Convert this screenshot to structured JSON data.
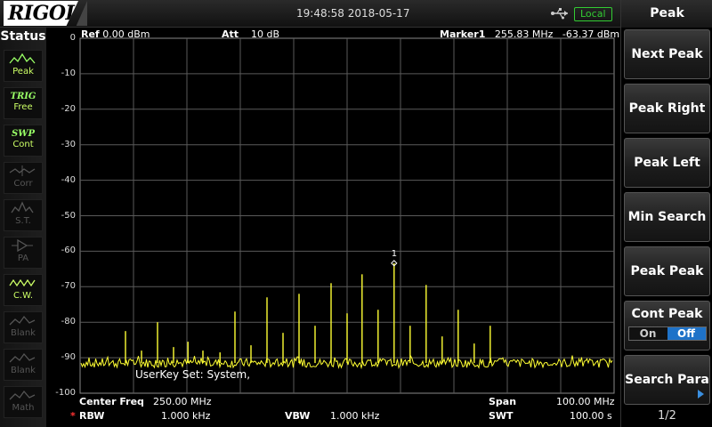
{
  "header": {
    "brand": "RIGOL",
    "datetime": "19:48:58 2018-05-17",
    "remote_status": "Local"
  },
  "status_panel": {
    "title": "Status",
    "items": [
      {
        "icon": "peak-icon",
        "top_label": "",
        "label": "Peak",
        "active": true
      },
      {
        "icon": "",
        "top_label": "TRIG",
        "label": "Free",
        "active": true
      },
      {
        "icon": "",
        "top_label": "SWP",
        "label": "Cont",
        "active": true
      },
      {
        "icon": "corr-icon",
        "top_label": "",
        "label": "Corr",
        "active": false
      },
      {
        "icon": "st-icon",
        "top_label": "",
        "label": "S.T.",
        "active": false
      },
      {
        "icon": "pa-icon",
        "top_label": "",
        "label": "PA",
        "active": false
      },
      {
        "icon": "cw-icon",
        "top_label": "",
        "label": "C.W.",
        "active": true
      },
      {
        "icon": "blank-icon",
        "top_label": "",
        "label": "Blank",
        "active": false
      },
      {
        "icon": "blank-icon",
        "top_label": "",
        "label": "Blank",
        "active": false
      },
      {
        "icon": "math-icon",
        "top_label": "",
        "label": "Math",
        "active": false
      }
    ]
  },
  "plot_header": {
    "ref_label": "Ref",
    "ref_value": "0.00 dBm",
    "att_label": "Att",
    "att_value": "10 dB",
    "marker_label": "Marker1",
    "marker_freq": "255.83 MHz",
    "marker_level": "-63.37 dBm"
  },
  "plot_footer": {
    "center_label": "Center Freq",
    "center_value": "250.00 MHz",
    "span_label": "Span",
    "span_value": "100.00 MHz",
    "rbw_star": "*",
    "rbw_label": "RBW",
    "rbw_value": "1.000 kHz",
    "vbw_label": "VBW",
    "vbw_value": "1.000 kHz",
    "swt_label": "SWT",
    "swt_value": "100.00 s"
  },
  "userkey_text": "UserKey Set:   System,",
  "marker_number": "1",
  "menu": {
    "title": "Peak",
    "buttons": [
      "Next Peak",
      "Peak Right",
      "Peak Left",
      "Min Search",
      "Peak Peak"
    ],
    "cont_peak": {
      "label": "Cont Peak",
      "on": "On",
      "off": "Off",
      "selected": "Off"
    },
    "search_para": "Search Para",
    "page": "1/2"
  },
  "colors": {
    "trace": "#ffff33",
    "grid": "#5a5a5a",
    "active_status": "#ccff66",
    "toggle_selected": "#1e72c8"
  },
  "chart_data": {
    "type": "line",
    "ylim": [
      -100,
      0
    ],
    "yticks": [
      "0",
      "-10",
      "-20",
      "-30",
      "-40",
      "-50",
      "-60",
      "-70",
      "-80",
      "-90",
      "-100"
    ],
    "xlim": [
      200,
      300
    ],
    "x_unit": "MHz",
    "y_unit": "dBm",
    "noise_floor": -91.5,
    "grid": true,
    "peaks": [
      {
        "x": 208.5,
        "y": -82.5
      },
      {
        "x": 211.5,
        "y": -88
      },
      {
        "x": 214.5,
        "y": -80
      },
      {
        "x": 217.5,
        "y": -87
      },
      {
        "x": 220.2,
        "y": -85.5
      },
      {
        "x": 223.0,
        "y": -88
      },
      {
        "x": 226.2,
        "y": -88.5
      },
      {
        "x": 229.0,
        "y": -77
      },
      {
        "x": 232.0,
        "y": -86.5
      },
      {
        "x": 235.0,
        "y": -73
      },
      {
        "x": 238.0,
        "y": -83
      },
      {
        "x": 241.0,
        "y": -72
      },
      {
        "x": 244.0,
        "y": -81
      },
      {
        "x": 247.0,
        "y": -69
      },
      {
        "x": 250.0,
        "y": -77.5
      },
      {
        "x": 252.8,
        "y": -66.5
      },
      {
        "x": 255.8,
        "y": -76.5
      },
      {
        "x": 258.8,
        "y": -63.37
      },
      {
        "x": 261.8,
        "y": -81
      },
      {
        "x": 264.8,
        "y": -69.5
      },
      {
        "x": 267.8,
        "y": -84
      },
      {
        "x": 270.8,
        "y": -76.5
      },
      {
        "x": 273.8,
        "y": -86
      },
      {
        "x": 276.8,
        "y": -81
      }
    ],
    "marker": {
      "id": "1",
      "x": 258.8,
      "y": -63.37
    }
  }
}
